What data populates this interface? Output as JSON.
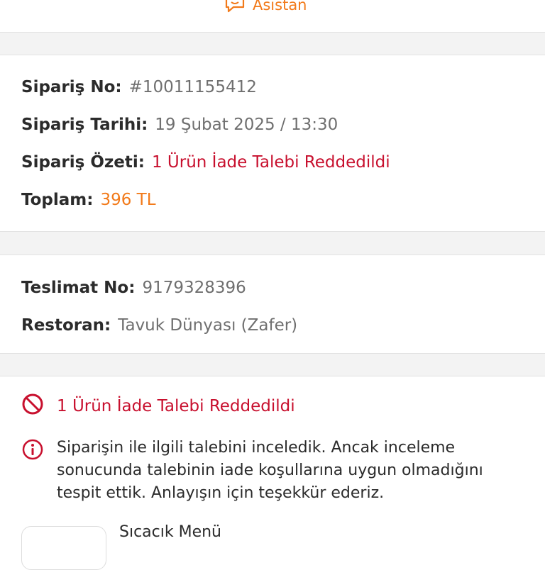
{
  "header": {
    "assistant_label": "Asistan",
    "assistant_icon": "chat-bubble-icon",
    "accent_color": "#f27a1a"
  },
  "order": {
    "no_label": "Sipariş No:",
    "no_value": "#10011155412",
    "date_label": "Sipariş Tarihi:",
    "date_value": "19 Şubat 2025 / 13:30",
    "summary_label": "Sipariş Özeti:",
    "summary_value": "1 Ürün İade Talebi Reddedildi",
    "total_label": "Toplam:",
    "total_value": "396 TL"
  },
  "delivery": {
    "no_label": "Teslimat No:",
    "no_value": "9179328396",
    "restaurant_label": "Restoran:",
    "restaurant_value": "Tavuk Dünyası (Zafer)"
  },
  "refund": {
    "status_icon": "prohibited-icon",
    "status_text": "1 Ürün İade Talebi Reddedildi",
    "status_color": "#c8102e",
    "info_icon": "info-icon",
    "info_text": "Siparişin ile ilgili talebini inceledik. Ancak inceleme sonucunda talebinin iade koşullarına uygun olmadığını tespit ettik. Anlayışın için teşekkür ederiz."
  },
  "product": {
    "name": "Sıcacık Menü"
  }
}
